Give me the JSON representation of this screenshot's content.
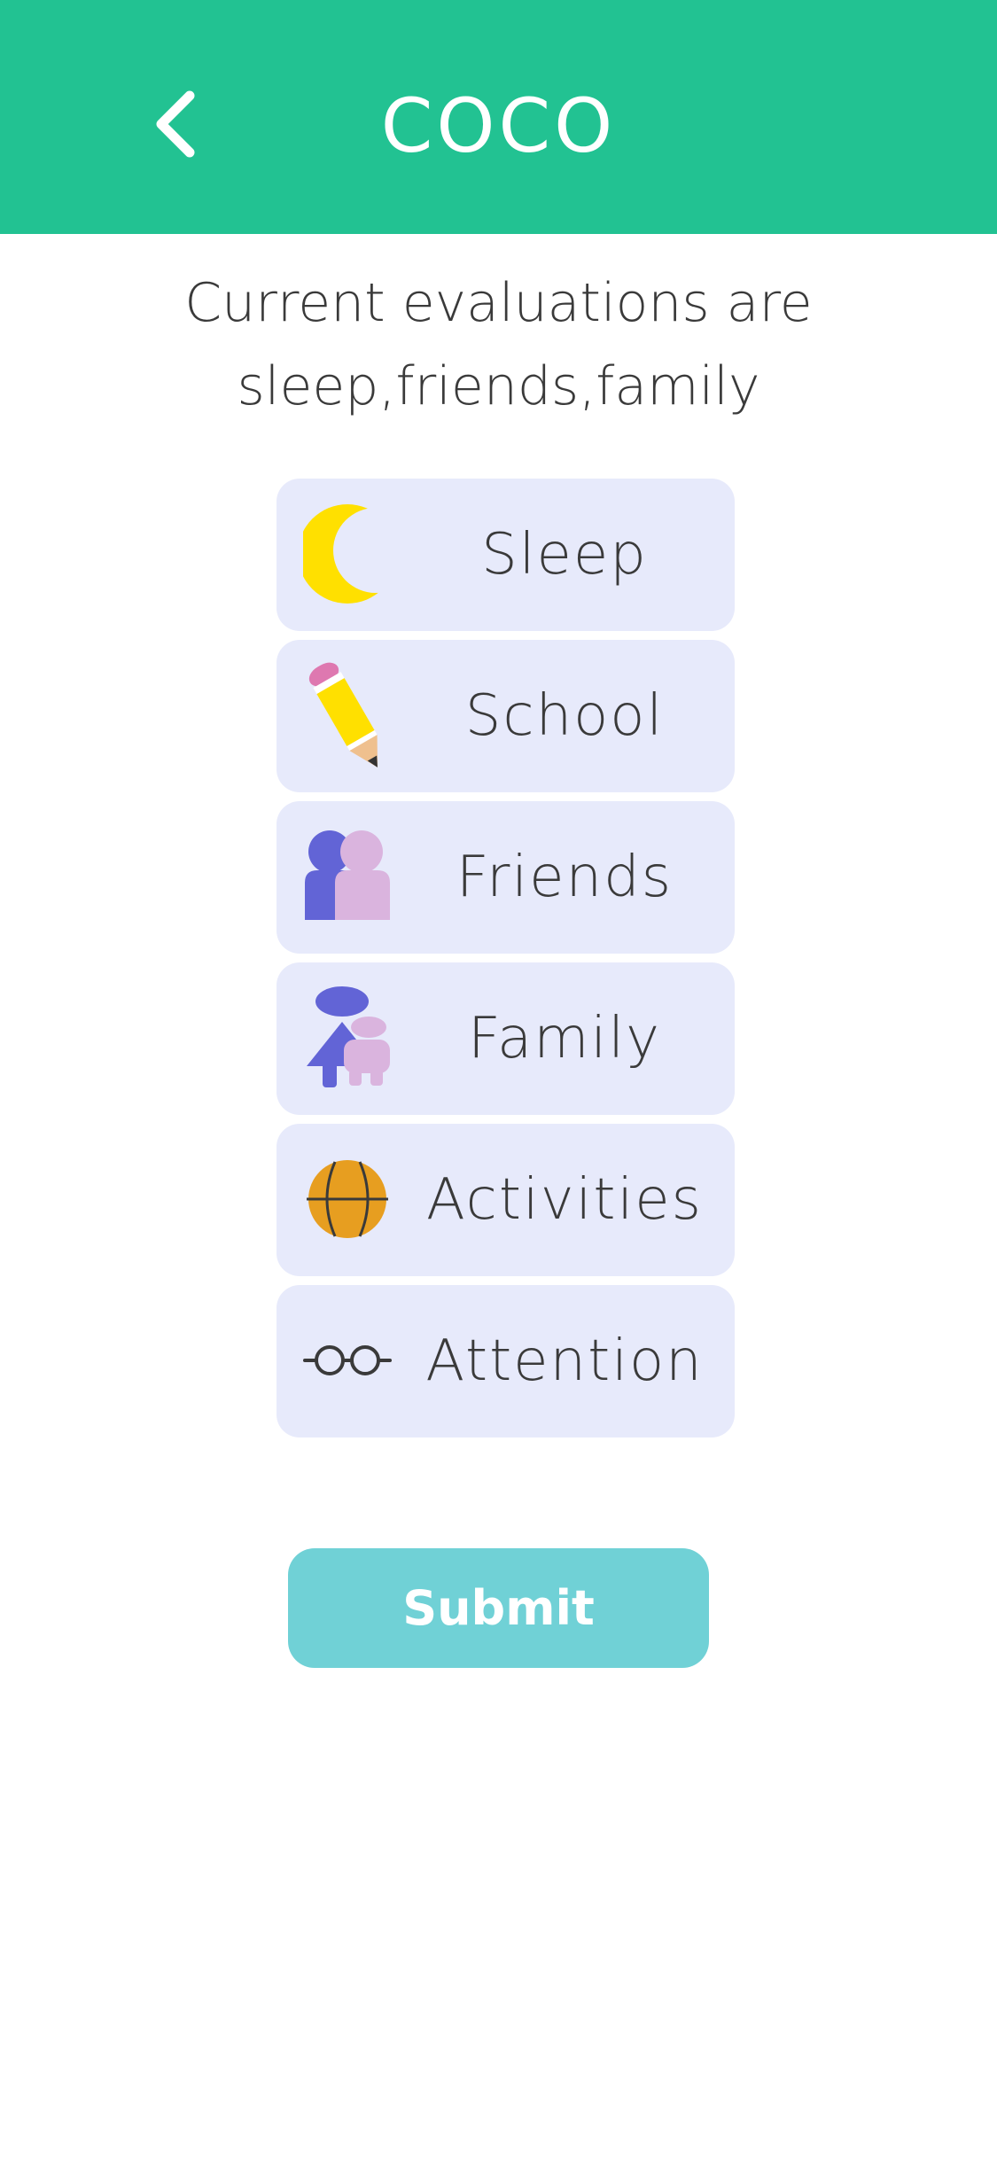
{
  "header": {
    "title": "COCO",
    "back_icon": "chevron-left-icon",
    "background": "#22c292"
  },
  "status": {
    "line1": "Current evaluations are",
    "line2": "sleep,friends,family"
  },
  "categories": [
    {
      "label": "Sleep",
      "icon": "moon-icon"
    },
    {
      "label": "School",
      "icon": "pencil-icon"
    },
    {
      "label": "Friends",
      "icon": "friends-icon"
    },
    {
      "label": "Family",
      "icon": "family-icon"
    },
    {
      "label": "Activities",
      "icon": "basketball-icon"
    },
    {
      "label": "Attention",
      "icon": "glasses-icon"
    }
  ],
  "card_background": "#e7eafb",
  "submit": {
    "label": "Submit",
    "background": "#70d1d6"
  }
}
